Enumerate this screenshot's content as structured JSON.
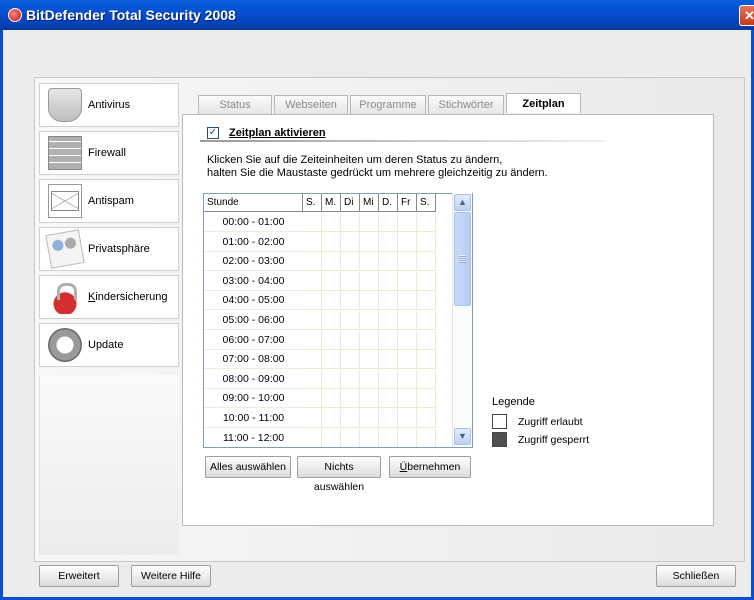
{
  "window": {
    "title": "BitDefender Total Security 2008",
    "close_glyph": "✕",
    "accent_color": "#0a5fd8"
  },
  "sidebar": {
    "items": [
      {
        "label": "Antivirus",
        "icon": "shield-icon"
      },
      {
        "label": "Firewall",
        "icon": "firewall-brick-icon"
      },
      {
        "label": "Antispam",
        "icon": "envelope-icon"
      },
      {
        "label": "Privatsphäre",
        "icon": "privacy-icon"
      },
      {
        "label": "Kindersicherung",
        "icon": "padlock-icon"
      },
      {
        "label": "Update",
        "icon": "update-disc-icon"
      }
    ]
  },
  "tabs": [
    {
      "label": "Status",
      "active": false
    },
    {
      "label": "Webseiten",
      "active": false
    },
    {
      "label": "Programme",
      "active": false
    },
    {
      "label": "Stichwörter",
      "active": false
    },
    {
      "label": "Zeitplan",
      "active": true
    }
  ],
  "schedule": {
    "enable_checkbox_label": "Zeitplan aktivieren",
    "enable_checked": true,
    "check_glyph": "✓",
    "instructions": [
      "Klicken Sie auf die Zeiteinheiten um deren Status zu ändern,",
      "halten Sie die Maustaste gedrückt um mehrere gleichzeitig zu ändern."
    ],
    "header_hour": "Stunde",
    "days": [
      "S.",
      "M.",
      "Di",
      "Mi",
      "D.",
      "Fr",
      "S."
    ],
    "hours": [
      "00:00 - 01:00",
      "01:00 - 02:00",
      "02:00 - 03:00",
      "03:00 - 04:00",
      "04:00 - 05:00",
      "05:00 - 06:00",
      "06:00 - 07:00",
      "07:00 - 08:00",
      "08:00 - 09:00",
      "09:00 - 10:00",
      "10:00 - 11:00",
      "11:00 - 12:00"
    ],
    "scroll_up_glyph": "▲",
    "scroll_down_glyph": "▼"
  },
  "actions": {
    "select_all": "Alles auswählen",
    "select_none": "Nichts auswählen",
    "apply": "Übernehmen"
  },
  "legend": {
    "title": "Legende",
    "allowed": {
      "label": "Zugriff erlaubt",
      "color": "#ffffff"
    },
    "blocked": {
      "label": "Zugriff gesperrt",
      "color": "#505050"
    }
  },
  "footer": {
    "advanced": "Erweitert",
    "more_help": "Weitere Hilfe",
    "close": "Schließen"
  }
}
